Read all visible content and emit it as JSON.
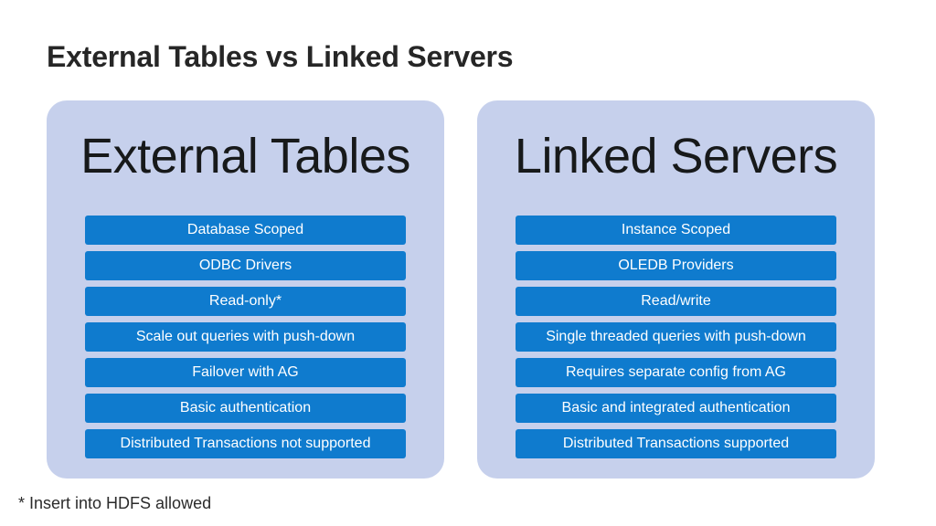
{
  "slide": {
    "title": "External Tables vs Linked Servers",
    "footnote": "* Insert into HDFS allowed",
    "colors": {
      "panel_background": "#c6d0ec",
      "bar_background": "#0f7bce",
      "bar_text": "#ffffff",
      "title_text": "#262626",
      "heading_text": "#17191a",
      "slide_background": "#ffffff"
    }
  },
  "panels": [
    {
      "heading": "External Tables",
      "items": [
        "Database Scoped",
        "ODBC Drivers",
        "Read-only*",
        "Scale out queries with push-down",
        "Failover with AG",
        "Basic authentication",
        "Distributed Transactions not supported"
      ]
    },
    {
      "heading": "Linked Servers",
      "items": [
        "Instance Scoped",
        "OLEDB Providers",
        "Read/write",
        "Single threaded queries with push-down",
        "Requires separate config from AG",
        "Basic and integrated authentication",
        "Distributed Transactions supported"
      ]
    }
  ]
}
